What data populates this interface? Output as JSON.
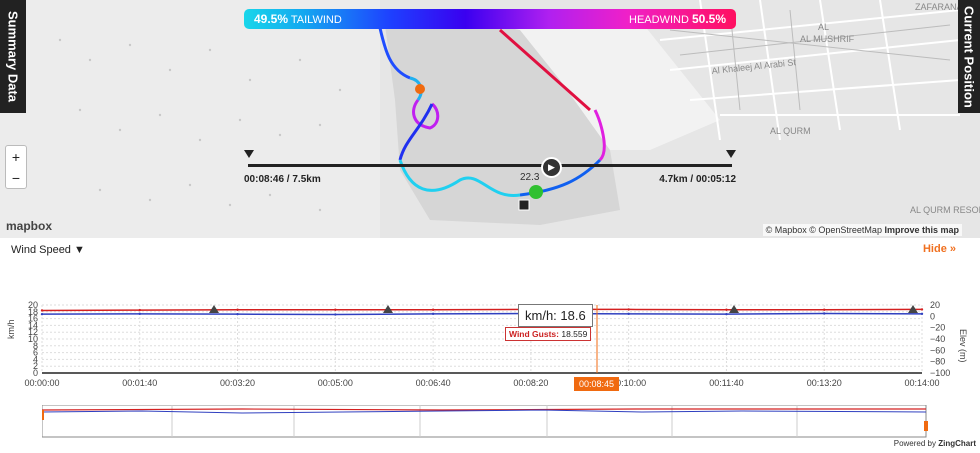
{
  "panels": {
    "left_tab": "Summary Data",
    "right_tab": "Current Position"
  },
  "zoom": {
    "plus": "+",
    "minus": "−"
  },
  "map": {
    "logo": "mapbox",
    "attribution": "© Mapbox © OpenStreetMap",
    "improve": "Improve this map",
    "labels": [
      "AL MUSHRIF",
      "Al Khaleej Al Arabi St",
      "AL QURM",
      "AL QURM RESORT",
      "ZAFARANA"
    ],
    "speed_label": "22.3"
  },
  "wind_bar": {
    "left_pct": "49.5%",
    "left_label": "TAILWIND",
    "right_label": "HEADWIND",
    "right_pct": "50.5%"
  },
  "timeline": {
    "left": "00:08:46 / 7.5km",
    "right": "4.7km / 00:05:12"
  },
  "controls": {
    "metric": "Wind Speed ▼",
    "hide": "Hide »"
  },
  "tooltip": {
    "main": "km/h: 18.6",
    "gust_key": "Wind Gusts:",
    "gust_val": "18.559",
    "time": "00:08:45"
  },
  "powered": {
    "text": "Powered by",
    "brand": "ZingChart"
  },
  "chart_data": {
    "type": "line",
    "x_ticks": [
      "00:00:00",
      "00:01:40",
      "00:03:20",
      "00:05:00",
      "00:06:40",
      "00:08:20",
      "00:10:00",
      "00:11:40",
      "00:13:20",
      "00:14:00"
    ],
    "ylabel": "km/h",
    "ylim": [
      0,
      20
    ],
    "y_ticks": [
      "0",
      "2",
      "4",
      "6",
      "8",
      "10",
      "12",
      "14",
      "16",
      "18",
      "20"
    ],
    "y2label": "Elev (m)",
    "y2lim": [
      -100,
      20
    ],
    "y2_ticks": [
      "−100",
      "−80",
      "−60",
      "−40",
      "−20",
      "0",
      "20"
    ],
    "series": [
      {
        "name": "Wind Gusts",
        "color": "#d42020",
        "values": [
          18.4,
          18.5,
          18.6,
          18.6,
          18.6,
          18.7,
          18.7,
          18.6,
          18.6,
          18.7
        ]
      },
      {
        "name": "km/h",
        "color": "#3040c0",
        "values": [
          17.3,
          17.4,
          17.3,
          17.2,
          17.4,
          17.5,
          17.4,
          17.3,
          17.5,
          17.4
        ]
      }
    ],
    "cursor_time": "00:08:45"
  }
}
